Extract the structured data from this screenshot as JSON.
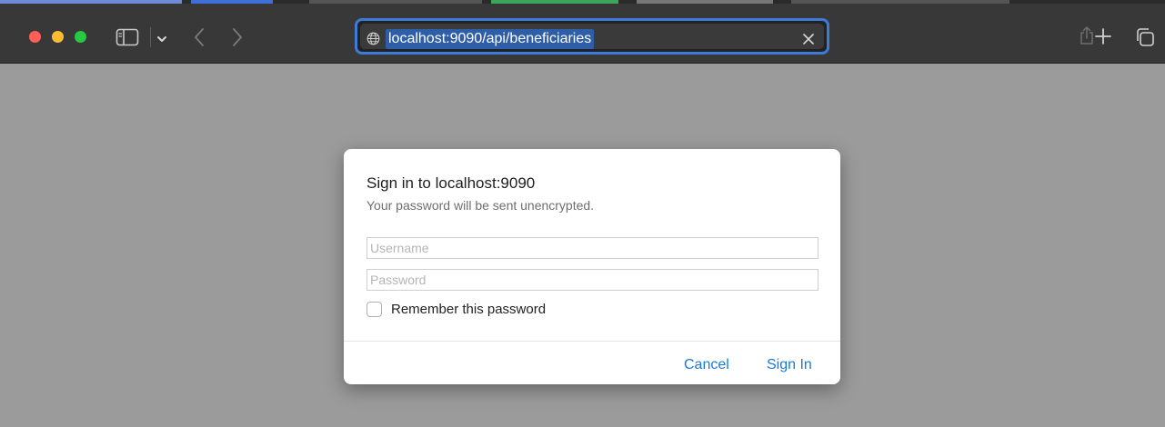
{
  "browser": {
    "address_bar": {
      "url": "localhost:9090/api/beneficiaries"
    },
    "icons": {
      "sidebar": "sidebar-icon",
      "sidebar_menu": "chevron-down-icon",
      "back": "chevron-left-icon",
      "forward": "chevron-right-icon",
      "site": "globe-icon",
      "clear": "close-icon",
      "share": "share-icon",
      "new_tab": "plus-icon",
      "tab_overview": "tabs-icon"
    },
    "colors": {
      "close": "#ff5f57",
      "minimize": "#febc2e",
      "zoom": "#28c840",
      "accent": "#3d7bd9"
    }
  },
  "auth_dialog": {
    "title": "Sign in to localhost:9090",
    "subtitle": "Your password will be sent unencrypted.",
    "username": {
      "value": "",
      "placeholder": "Username"
    },
    "password": {
      "value": "",
      "placeholder": "Password"
    },
    "remember": {
      "label": "Remember this password",
      "checked": false
    },
    "cancel_label": "Cancel",
    "sign_in_label": "Sign In",
    "button_color": "#1a7ad9"
  }
}
